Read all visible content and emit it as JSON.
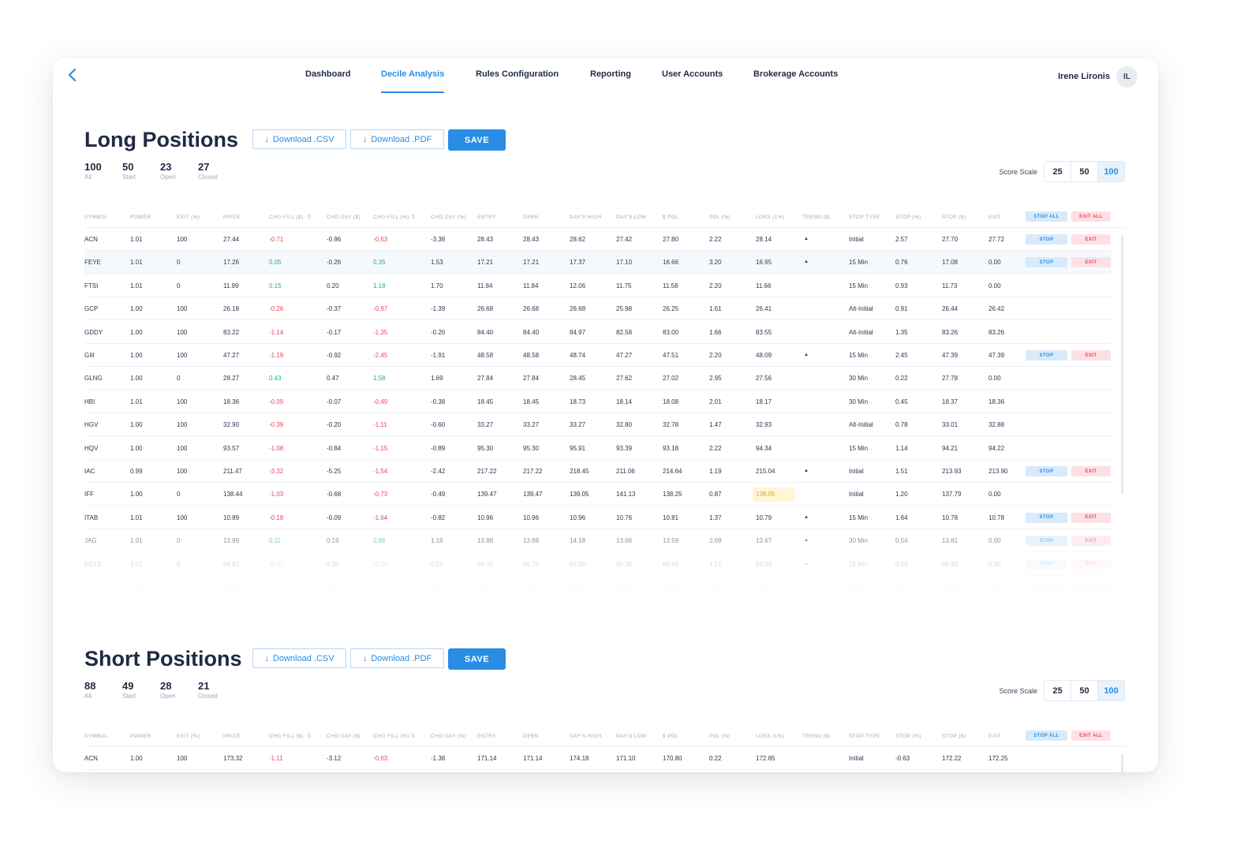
{
  "nav": {
    "items": [
      "Dashboard",
      "Decile Analysis",
      "Rules Configuration",
      "Reporting",
      "User Accounts",
      "Brokerage Accounts"
    ],
    "active": "Decile Analysis",
    "user_name": "Irene Lironis",
    "user_initials": "IL"
  },
  "columns": [
    "SYMBOL",
    "POWER",
    "EXIT (%)",
    "PRICE",
    "CHG FILL ($)",
    "CHG DAY ($)",
    "CHG FILL (%)",
    "CHG DAY (%)",
    "ENTRY",
    "OPEN",
    "DAY'S HIGH",
    "DAY'S LOW",
    "$ PDL",
    "PDL (%)",
    "LOSS (1%)",
    "TREND ($)",
    "STOP TYPE",
    "STOP (%)",
    "STOP ($)",
    "EXIT"
  ],
  "buttons": {
    "download_csv": "Download .CSV",
    "download_pdf": "Download .PDF",
    "save": "SAVE",
    "stop_all": "STOP ALL",
    "exit_all": "EXIT ALL",
    "stop": "STOP",
    "exit": "EXIT"
  },
  "score_scale": {
    "label": "Score Scale",
    "options": [
      "25",
      "50",
      "100"
    ],
    "selected": "100"
  },
  "long": {
    "title": "Long Positions",
    "stats": [
      {
        "value": "100",
        "label": "All"
      },
      {
        "value": "50",
        "label": "Start"
      },
      {
        "value": "23",
        "label": "Open"
      },
      {
        "value": "27",
        "label": "Closed"
      }
    ],
    "rows": [
      [
        "ACN",
        "1.01",
        "100",
        "27.44",
        "-0.71",
        "-0.96",
        "-0,63",
        "-3.38",
        "28.43",
        "28.43",
        "28.62",
        "27.42",
        "27.80",
        "2.22",
        "28.14",
        "up",
        "Initial",
        "2.57",
        "27.70",
        "27.72",
        true
      ],
      [
        "FEYE",
        "1.01",
        "0",
        "17.26",
        "0.05",
        "-0.26",
        "0,35",
        "1.53",
        "17.21",
        "17.21",
        "17.37",
        "17.10",
        "16.66",
        "3.20",
        "16.95",
        "up",
        "15 Min",
        "0.76",
        "17.08",
        "0.00",
        true
      ],
      [
        "FTSI",
        "1.01",
        "0",
        "11.99",
        "0.15",
        "0.20",
        "1,18",
        "1.70",
        "11.84",
        "11.84",
        "12.06",
        "11.75",
        "11.58",
        "2.20",
        "11.66",
        "",
        "15 Min",
        "0.93",
        "11.73",
        "0.00",
        false
      ],
      [
        "GCP",
        "1.00",
        "100",
        "26.18",
        "-0.26",
        "-0.37",
        "-0,97",
        "-1.39",
        "26.68",
        "26.68",
        "26.68",
        "25.98",
        "26.25",
        "1.61",
        "26.41",
        "",
        "Alt-Initial",
        "0.91",
        "26.44",
        "26.42",
        false
      ],
      [
        "GDDY",
        "1.00",
        "100",
        "83.22",
        "-1.14",
        "-0.17",
        "-1,35",
        "-0.20",
        "84.40",
        "84.40",
        "84.97",
        "82.58",
        "83.00",
        "1.66",
        "83.55",
        "",
        "Alt-Initial",
        "1.35",
        "83.26",
        "83.26",
        false
      ],
      [
        "GIII",
        "1.00",
        "100",
        "47.27",
        "-1.19",
        "-0.92",
        "-2,45",
        "-1.91",
        "48.58",
        "48.58",
        "48.74",
        "47.27",
        "47.51",
        "2.20",
        "48.09",
        "up",
        "15 Min",
        "2.45",
        "47.39",
        "47.39",
        true
      ],
      [
        "GLNG",
        "1.00",
        "0",
        "28.27",
        "0.43",
        "0.47",
        "1,58",
        "1.69",
        "27.84",
        "27.84",
        "28.45",
        "27.62",
        "27.02",
        "2.95",
        "27.56",
        "",
        "30 Min",
        "0.22",
        "27.78",
        "0.00",
        false
      ],
      [
        "HBI",
        "1.01",
        "100",
        "18.36",
        "-0.09",
        "-0.07",
        "-0,49",
        "-0.38",
        "18.45",
        "18.45",
        "18.73",
        "18.14",
        "18.08",
        "2.01",
        "18.17",
        "",
        "30 Min",
        "0.45",
        "18.37",
        "18.36",
        false
      ],
      [
        "HGV",
        "1.00",
        "100",
        "32.90",
        "-0.39",
        "-0.20",
        "-1,11",
        "-0.60",
        "33.27",
        "33.27",
        "33.27",
        "32.80",
        "32.78",
        "1.47",
        "32.93",
        "",
        "Alt-Initial",
        "0.78",
        "33.01",
        "32.88",
        false
      ],
      [
        "HQV",
        "1.00",
        "100",
        "93.57",
        "-1.08",
        "-0.84",
        "-1,15",
        "-0.89",
        "95.30",
        "95.30",
        "95.91",
        "93.39",
        "93.18",
        "2.22",
        "94.34",
        "",
        "15 Min",
        "1.14",
        "94.21",
        "94.22",
        false
      ],
      [
        "IAC",
        "0.99",
        "100",
        "211.47",
        "-3.32",
        "-5.25",
        "-1,54",
        "-2.42",
        "217.22",
        "217.22",
        "218.45",
        "211.06",
        "214.64",
        "1.19",
        "215.04",
        "up",
        "Initial",
        "1.51",
        "213.93",
        "213.90",
        true
      ],
      [
        "IFF",
        "1.00",
        "0",
        "138.44",
        "-1.03",
        "-0.68",
        "-0,73",
        "-0.49",
        "139.47",
        "139.47",
        "139.05",
        "141.13",
        "138.25",
        "0.87",
        "138.05",
        "",
        "Initial",
        "1.20",
        "137.79",
        "0.00",
        false
      ],
      [
        "ITAB",
        "1.01",
        "100",
        "10.89",
        "-0.18",
        "-0.09",
        "-1,64",
        "-0.82",
        "10.96",
        "10.96",
        "10.96",
        "10.76",
        "10.81",
        "1.37",
        "10.79",
        "up",
        "15 Min",
        "1.64",
        "10.78",
        "10.78",
        true
      ],
      [
        "JAG",
        "1.01",
        "0",
        "13.99",
        "0.11",
        "0.16",
        "0,86",
        "1.16",
        "13.88",
        "13.88",
        "14.18",
        "13.66",
        "13.59",
        "2.09",
        "13.67",
        "up",
        "30 Min",
        "0.54",
        "13.81",
        "0.00",
        true
      ],
      [
        "KEYS",
        "1.01",
        "0",
        "66.63",
        "-0.07",
        "0.35",
        "-0,03",
        "0.53",
        "66.70",
        "66.70",
        "67.00",
        "66.35",
        "65.69",
        "1.51",
        "66.03",
        "up",
        "15 Min",
        "0.55",
        "66.33",
        "0.00",
        true
      ],
      [
        "KS",
        "1.00",
        "0",
        "14.07",
        "-0.34",
        "0.36",
        "-1,11",
        "-2.23",
        "14.41",
        "14.41",
        "14.22",
        "14.15",
        "14.04",
        "0.21",
        "13.98",
        "",
        "Initial",
        "0.62",
        "14.16",
        "0.00",
        true
      ]
    ]
  },
  "short": {
    "title": "Short Positions",
    "stats": [
      {
        "value": "88",
        "label": "All"
      },
      {
        "value": "49",
        "label": "Start"
      },
      {
        "value": "28",
        "label": "Open"
      },
      {
        "value": "21",
        "label": "Closed"
      }
    ],
    "rows": [
      [
        "ACN",
        "1.00",
        "100",
        "173.32",
        "-1.11",
        "-3.12",
        "-0,63",
        "-1.38",
        "171.14",
        "171.14",
        "174.18",
        "171.10",
        "170.80",
        "0.22",
        "172.85",
        "",
        "Initial",
        "-0.63",
        "172.22",
        "172.25",
        false
      ]
    ]
  }
}
